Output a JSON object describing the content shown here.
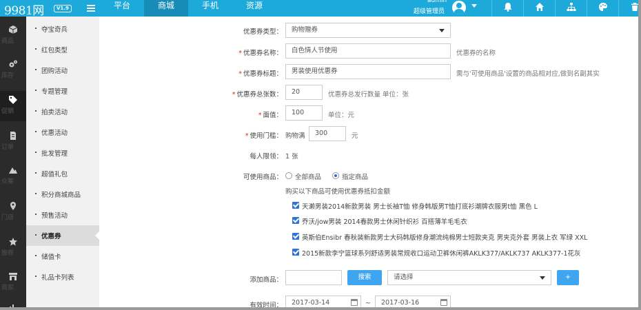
{
  "brand": {
    "name": "9981网",
    "version": "V1.9"
  },
  "top_nav": [
    {
      "label": "平台",
      "active": false
    },
    {
      "label": "商城",
      "active": true
    },
    {
      "label": "手机",
      "active": false
    },
    {
      "label": "资源",
      "active": false
    }
  ],
  "user": {
    "name": "admin",
    "role": "超级管理员"
  },
  "colors": {
    "topbar": "#1da9d9",
    "topbar_active": "#168cb6",
    "rail": "#2b2b2b",
    "button": "#3fa5f1",
    "required": "#e0261b",
    "checkbox": "#2f74d6"
  },
  "top_icons": [
    "bell-icon",
    "home-icon",
    "sitemap-icon",
    "palette-icon",
    "trash-icon"
  ],
  "rail": [
    {
      "label": "商品",
      "icon": "box-icon"
    },
    {
      "label": "库存",
      "icon": "gears-icon"
    },
    {
      "label": "促销",
      "icon": "tag-icon",
      "active": true
    },
    {
      "label": "订单",
      "icon": "document-icon"
    },
    {
      "label": "众筹",
      "icon": "mountain-icon"
    },
    {
      "label": "门店",
      "icon": "location-pin-icon"
    },
    {
      "label": "推荐",
      "icon": "star-icon"
    },
    {
      "label": "商家",
      "icon": "store-icon"
    }
  ],
  "submenu": [
    {
      "label": "夺宝奇兵"
    },
    {
      "label": "红包类型"
    },
    {
      "label": "团购活动"
    },
    {
      "label": "专题管理"
    },
    {
      "label": "拍卖活动"
    },
    {
      "label": "优惠活动"
    },
    {
      "label": "批发管理"
    },
    {
      "label": "超值礼包"
    },
    {
      "label": "积分商城商品"
    },
    {
      "label": "预售活动"
    },
    {
      "label": "优惠券",
      "active": true
    },
    {
      "label": "储值卡"
    },
    {
      "label": "礼品卡列表"
    }
  ],
  "form": {
    "type": {
      "label": "优惠券类型：",
      "value": "购物赠券"
    },
    "name": {
      "label": "优惠券名称：",
      "value": "白色情人节使用",
      "hint": "优惠券的名称"
    },
    "title": {
      "label": "优惠券标题：",
      "value": "男装使用优惠券",
      "hint": "需与'可使用商品'设置的商品相对应,做到名副其实"
    },
    "total": {
      "label": "优惠券总张数：",
      "value": "20",
      "hint": "优惠券总发行数量 单位：张"
    },
    "face_value": {
      "label": "面值：",
      "value": "100",
      "hint": "单位：元"
    },
    "threshold": {
      "label": "使用门槛：",
      "prefix": "购物满",
      "value": "300",
      "suffix": "元"
    },
    "per_person": {
      "label": "每人限领：",
      "value": "1 张"
    },
    "usable": {
      "label": "可使用商品：",
      "option_all": "全部商品",
      "option_specified": "指定商品",
      "selected": "指定商品",
      "hint": "购买以下商品可使用优惠券抵扣金额"
    },
    "products": [
      "天濑男装2014新款男装 男士长袖T恤 修身韩版男T恤打底衫潮牌衣服男t恤 黑色 L",
      "乔沃/jow男装 2014春款男士休闲针织衫 百搭薄羊毛毛衣",
      "英斯伯Ensibr 春秋装新款男士大码韩版修身潮流纯棉男士短款夹克 男夹克外套 男装上衣 军绿 XXL",
      "2015新款李宁篮球系列舒适男装常规收口运动卫裤休闲裤AKLK377/AKLK737 AKLK377-1花灰"
    ],
    "add_product": {
      "label": "添加商品：",
      "search_value": "",
      "search_button": "搜索",
      "select_placeholder": "请选择",
      "add_button": "+"
    },
    "validity": {
      "label": "有效时间：",
      "start": "2017-03-14",
      "separator": "~",
      "end": "2017-03-16"
    }
  }
}
